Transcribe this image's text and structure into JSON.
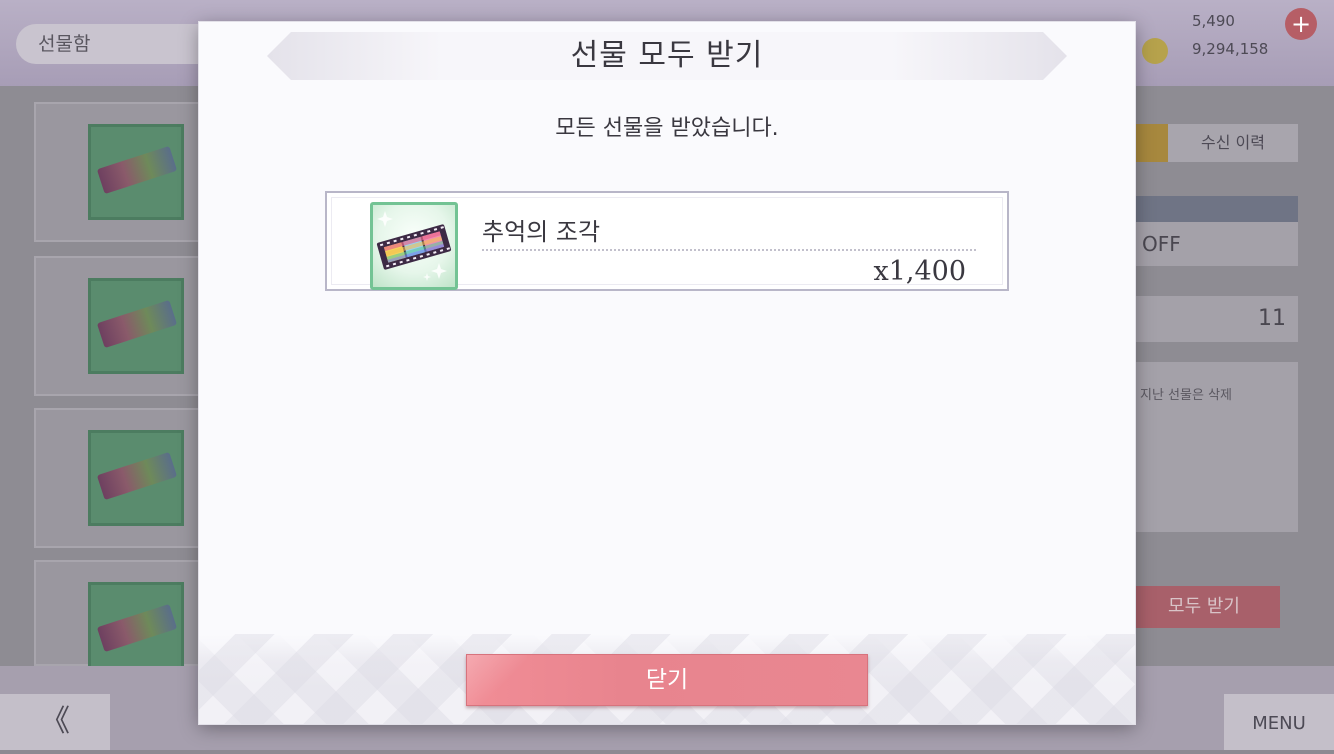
{
  "background": {
    "screen_title": "선물함",
    "top_menu": "",
    "currency_1": "5,490",
    "currency_2": "9,294,158",
    "plus_label": "+",
    "receive_history_tab": "수신 이력",
    "sort_toggle_value": "OFF",
    "gift_count": "11",
    "notice_text": "지난 선물은 삭제",
    "receive_all_button": "모두 받기",
    "back_label": "《",
    "menu_label": "MENU"
  },
  "modal": {
    "title": "선물 모두 받기",
    "message": "모든 선물을 받았습니다.",
    "items": [
      {
        "name": "추억의 조각",
        "quantity": "x1,400",
        "icon": "memory-fragment-film-icon"
      }
    ],
    "close_button": "닫기"
  },
  "colors": {
    "close_button": "#e8848e",
    "item_frame": "#73c394",
    "item_border": "#b8b6c8"
  }
}
